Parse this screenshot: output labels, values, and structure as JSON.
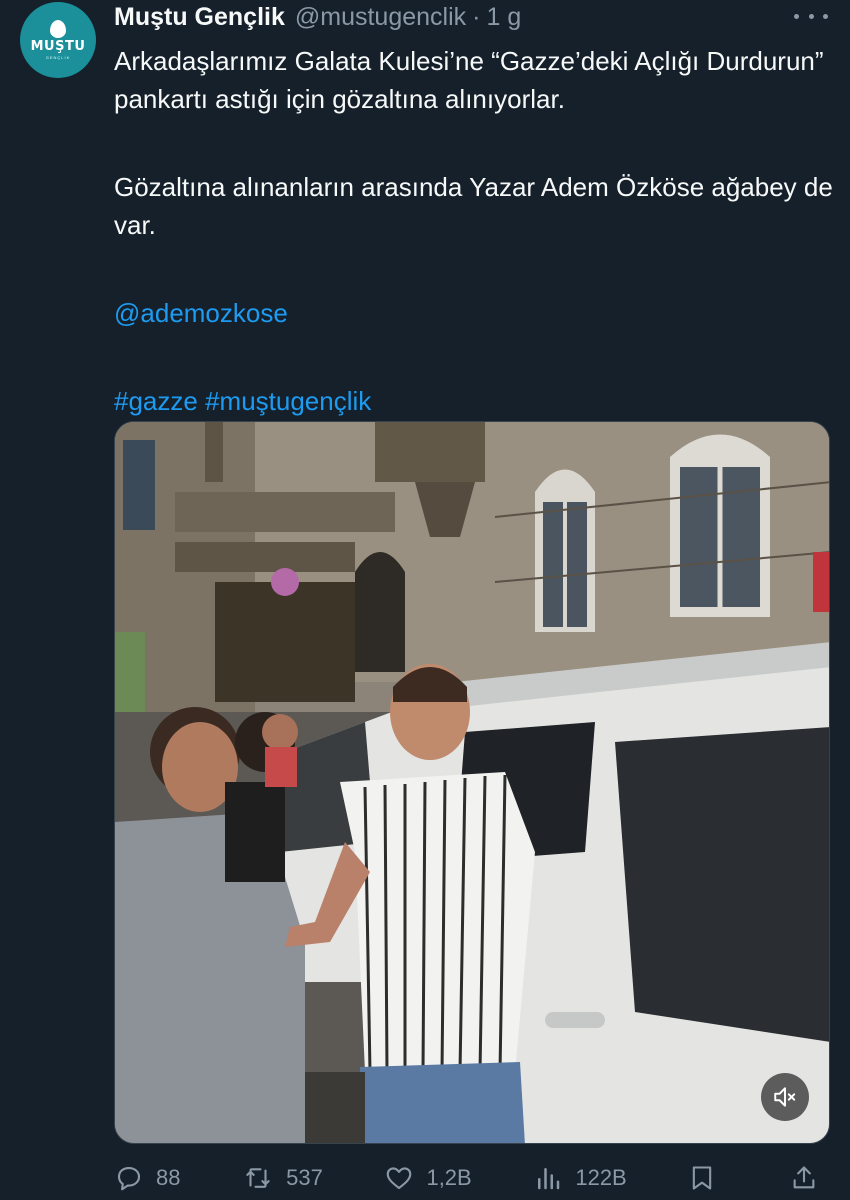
{
  "tweet": {
    "display_name": "Muştu Gençlik",
    "handle": "@mustugenclik",
    "separator": "·",
    "time": "1 g",
    "avatar": {
      "logo_text": "MUŞTU",
      "logo_sub": "GENÇLİK",
      "color": "#1b8f9a"
    },
    "text": {
      "line1": "Arkadaşlarımız  Galata Kulesi’ne “Gazze’deki Açlığı Durdurun” pankartı astığı için gözaltına alınıyorlar.",
      "line2": "Gözaltına alınanların arasında Yazar Adem Özköse ağabey de var.",
      "mention": "@ademozkose",
      "hashtag1": "#gazze",
      "hashtag2": "#muştugençlik"
    },
    "media": {
      "type": "video",
      "muted_icon": "speaker-muted-icon"
    },
    "actions": {
      "replies": "88",
      "retweets": "537",
      "likes": "1,2B",
      "views": "122B",
      "icons": [
        "reply-icon",
        "retweet-icon",
        "like-icon",
        "views-icon",
        "bookmark-icon",
        "share-icon"
      ]
    }
  },
  "colors": {
    "background": "#15202b",
    "text": "#f7f9f9",
    "secondary": "#8b98a5",
    "link": "#1d9bf0"
  }
}
